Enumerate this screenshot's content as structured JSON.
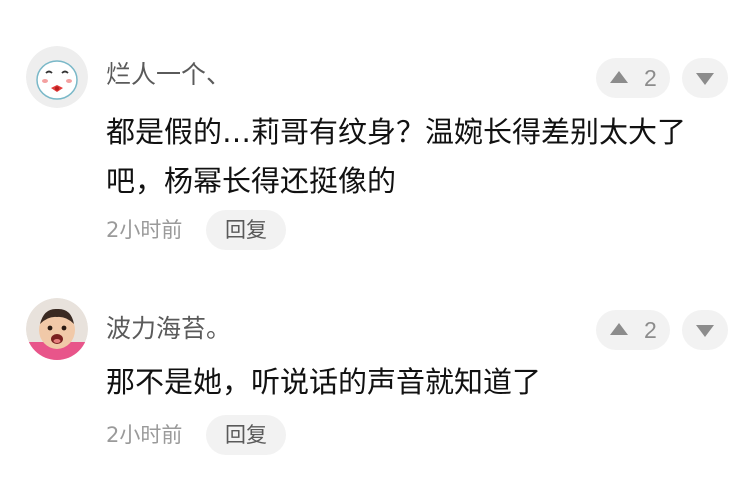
{
  "comments": [
    {
      "username": "烂人一个、",
      "avatar_icon": "sticker-face-icon",
      "upvotes": "2",
      "text": "都是假的…莉哥有纹身？温婉长得差别太大了吧，杨幂长得还挺像的",
      "time": "2小时前",
      "reply_label": "回复"
    },
    {
      "username": "波力海苔。",
      "avatar_icon": "baby-photo-avatar",
      "upvotes": "2",
      "text": "那不是她，听说话的声音就知道了",
      "time": "2小时前",
      "reply_label": "回复"
    }
  ],
  "colors": {
    "username": "#5a5a5a",
    "body": "#111111",
    "meta": "#9a9a9a",
    "pill_bg": "#f2f2f2"
  }
}
